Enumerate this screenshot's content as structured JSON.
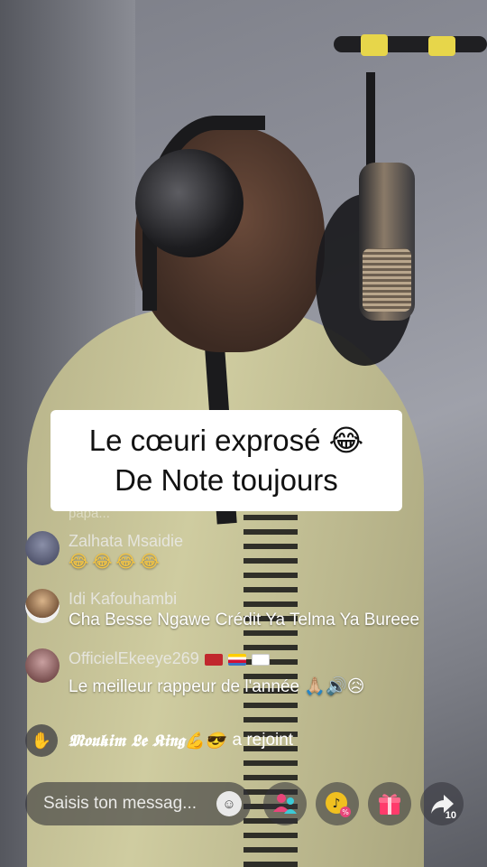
{
  "caption": {
    "line1": "Le cœuri exprosé 😂",
    "line2": "De Note toujours"
  },
  "partial_comment": "papa...",
  "comments": [
    {
      "username": "Zalhata Msaidie",
      "text": "😂😂😂😂"
    },
    {
      "username": "Idi Kafouhambi",
      "text": "Cha Besse Ngawe Crédit Ya Telma Ya Bureee"
    },
    {
      "username": "OfficielEkeeye269",
      "text": "Le meilleur rappeur de l'année 🙏🏼🔊😥"
    }
  ],
  "join": {
    "username": "𝕸𝖔𝖚𝖐𝖎𝖒 𝕷𝖊 𝕶𝖎𝖓𝖌💪😎",
    "text": "a rejoint"
  },
  "message_input": {
    "placeholder": "Saisis ton messag..."
  },
  "share_count": "10",
  "icons": {
    "wave": "wave-hand-icon",
    "emoji": "emoji-icon",
    "guests": "guests-icon",
    "tiktok_coin": "tiktok-coin-icon",
    "gift": "gift-icon",
    "share": "share-icon"
  },
  "colors": {
    "guests": "#e8457a",
    "gift": "#ff3b6b",
    "coin": "#f0c020"
  }
}
